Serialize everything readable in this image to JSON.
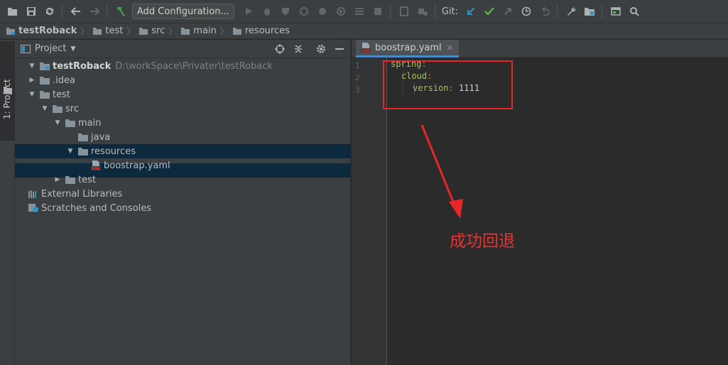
{
  "toolbar": {
    "run_config_label": "Add Configuration...",
    "git_label": "Git:",
    "colors": {
      "git_update": "#3592c4",
      "git_commit": "#62b543",
      "build": "#499c54"
    }
  },
  "breadcrumb": [
    "testRoback",
    "test",
    "src",
    "main",
    "resources"
  ],
  "stripe": {
    "label": "1: Project"
  },
  "project_panel": {
    "title": "Project",
    "tree": [
      {
        "label": "testRoback",
        "path": "D:\\workSpace\\Privater\\testRoback",
        "expanded": true,
        "icon": "module-folder-icon"
      },
      {
        "label": ".idea",
        "expanded": false,
        "icon": "folder-icon"
      },
      {
        "label": "test",
        "expanded": true,
        "icon": "folder-icon"
      },
      {
        "label": "src",
        "expanded": true,
        "icon": "folder-icon"
      },
      {
        "label": "main",
        "expanded": true,
        "icon": "folder-icon"
      },
      {
        "label": "java",
        "icon": "folder-icon"
      },
      {
        "label": "resources",
        "expanded": true,
        "selected": true,
        "icon": "folder-icon"
      },
      {
        "label": "boostrap.yaml",
        "icon": "yaml-file-icon"
      },
      {
        "label": "test",
        "expanded": false,
        "icon": "folder-icon"
      },
      {
        "label": "External Libraries",
        "icon": "libraries-icon"
      },
      {
        "label": "Scratches and Consoles",
        "icon": "scratches-icon"
      }
    ]
  },
  "editor": {
    "tab_label": "boostrap.yaml",
    "line_numbers": [
      "1",
      "2",
      "3"
    ],
    "lines": [
      {
        "key": "spring",
        "colon": ":",
        "value": ""
      },
      {
        "key": "cloud",
        "colon": ":",
        "value": ""
      },
      {
        "key": "version",
        "colon": ":",
        "value": " 1111"
      }
    ]
  },
  "annotation": {
    "text": "成功回退",
    "color": "#e8262a"
  }
}
